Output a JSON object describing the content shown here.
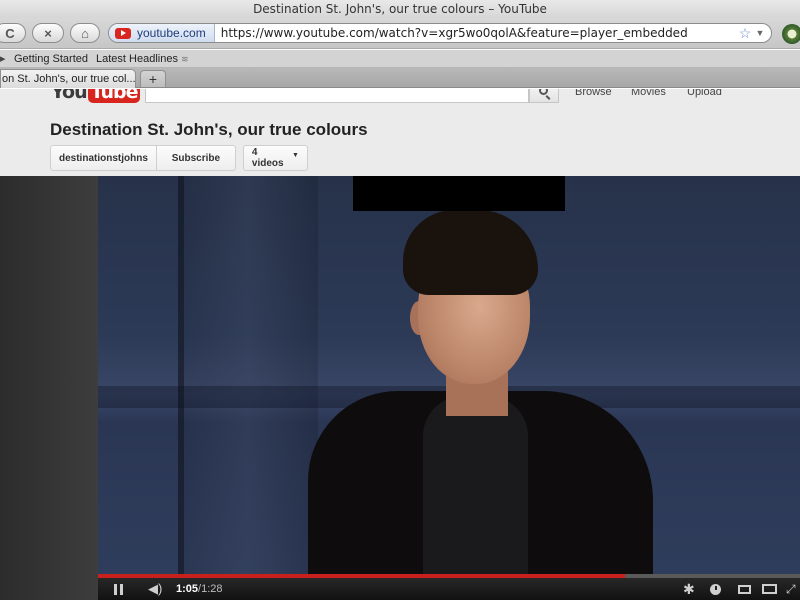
{
  "window": {
    "title": "Destination St. John's, our true colours – YouTube"
  },
  "toolbar": {
    "identity_label": "youtube.com",
    "url": "https://www.youtube.com/watch?v=xgr5wo0qolA&feature=player_embedded",
    "reload_glyph": "C",
    "stop_glyph": "×",
    "home_glyph": "⌂",
    "star_glyph": "☆",
    "dropdown_glyph": "▼"
  },
  "bookmarks": {
    "overflow_glyph": "▸",
    "items": [
      {
        "label": "Getting Started"
      },
      {
        "label": "Latest Headlines"
      }
    ],
    "rss_glyph": "≋"
  },
  "tabs": {
    "active_label": "on St. John's, our true col...",
    "new_tab_glyph": "+"
  },
  "youtube": {
    "logo_you": "You",
    "logo_tube": "Tube",
    "nav": {
      "browse": "Browse",
      "movies": "Movies",
      "upload": "Upload"
    },
    "video_title": "Destination St. John's, our true colours",
    "channel_name": "destinationstjohns",
    "subscribe_label": "Subscribe",
    "videos_label": "4 videos",
    "videos_caret": "▼"
  },
  "player": {
    "current_time": "1:05",
    "separator": " / ",
    "duration": "1:28",
    "progress_fraction": 0.75,
    "progress_color": "#c8201d",
    "volume_glyph": "◀)",
    "gear_glyph": "✱",
    "fullscreen_glyph": "⤢"
  },
  "icons": {
    "reload": "reload-icon",
    "stop": "stop-icon",
    "home": "home-icon",
    "favicon": "youtube-favicon-icon",
    "star": "bookmark-star-icon",
    "rss": "rss-icon",
    "search": "search-icon",
    "pause": "pause-icon",
    "volume": "volume-icon",
    "settings": "gear-icon",
    "watch_later": "clock-icon",
    "small_player": "small-player-icon",
    "large_player": "large-player-icon",
    "fullscreen": "fullscreen-icon"
  }
}
